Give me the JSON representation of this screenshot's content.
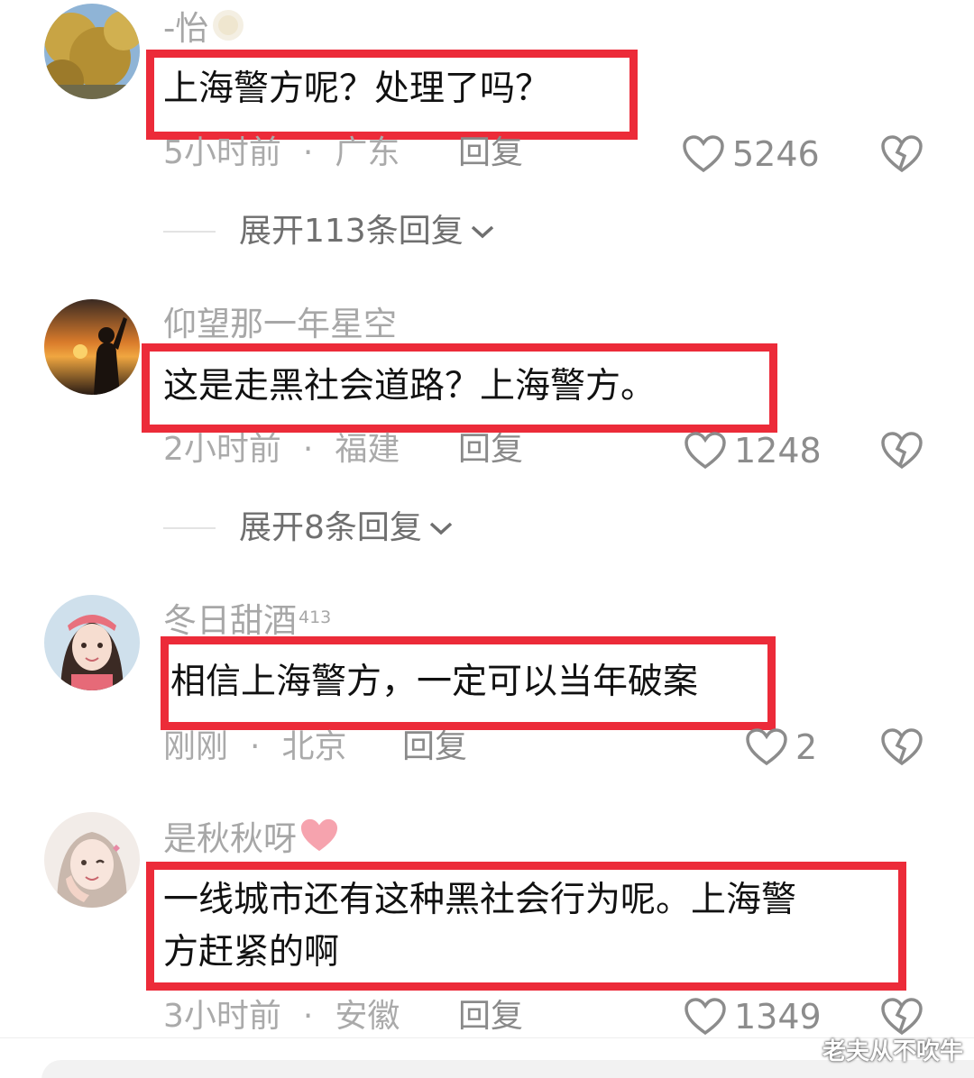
{
  "comments": [
    {
      "username": "-怡",
      "username_badge": "",
      "text": "上海警方呢？处理了吗？",
      "time": "5小时前",
      "location": "广东",
      "reply_label": "回复",
      "likes": "5246",
      "expand_label": "展开113条回复",
      "avatar": "tree-avatar-icon"
    },
    {
      "username": "仰望那一年星空",
      "text": "这是走黑社会道路？上海警方。",
      "time": "2小时前",
      "location": "福建",
      "reply_label": "回复",
      "likes": "1248",
      "expand_label": "展开8条回复",
      "avatar": "sunset-avatar-icon"
    },
    {
      "username": "冬日甜酒",
      "username_sup": "413",
      "text": "相信上海警方，一定可以当年破案",
      "time": "刚刚",
      "location": "北京",
      "reply_label": "回复",
      "likes": "2",
      "avatar": "girl-avatar-icon"
    },
    {
      "username": "是秋秋呀",
      "text_line1": "一线城市还有这种黑社会行为呢。上海警",
      "text_line2": "方赶紧的啊",
      "time": "3小时前",
      "location": "安徽",
      "reply_label": "回复",
      "likes": "1349",
      "avatar": "girl2-avatar-icon"
    }
  ],
  "separator": "·",
  "watermark": "老夫从不吹牛",
  "colors": {
    "highlight_box": "#ec2b39",
    "meta_text": "#aaaaaa",
    "username_text": "#a7a7a7",
    "heart_badge": "#f6a3ae"
  }
}
